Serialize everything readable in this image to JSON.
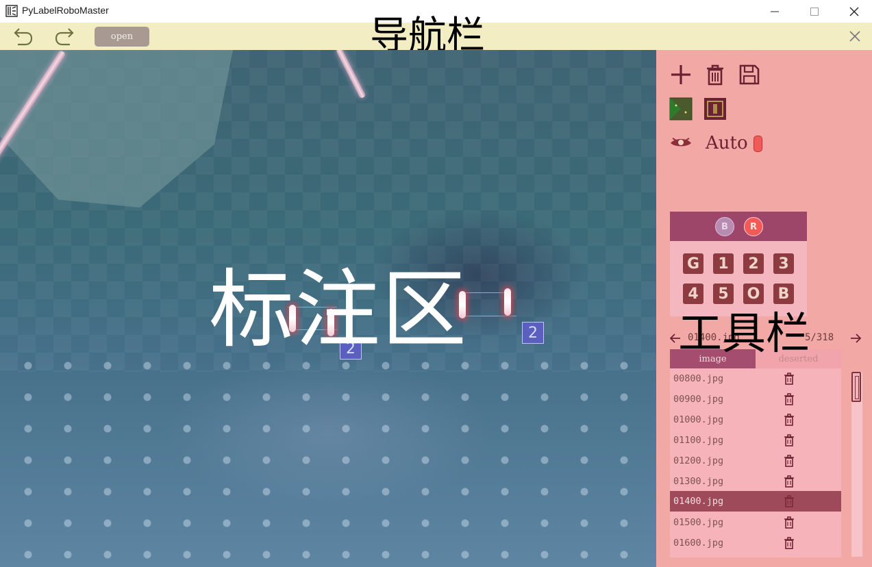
{
  "window": {
    "title": "PyLabelRoboMaster",
    "controls": [
      "minimize",
      "maximize",
      "close"
    ]
  },
  "navbar": {
    "undo_icon": "undo-arrow-icon",
    "redo_icon": "redo-arrow-icon",
    "open_label": "open",
    "overlay_label": "导航栏",
    "close_icon": "close-icon"
  },
  "canvas": {
    "overlay_label": "标注区",
    "armor_badges": [
      "2",
      "2"
    ]
  },
  "toolbar": {
    "overlay_label": "工具栏",
    "tools": [
      "add-icon",
      "delete-icon",
      "save-icon",
      "grid-icon",
      "box-icon",
      "eye-icon"
    ],
    "auto_label": "Auto",
    "team_buttons": [
      "B",
      "R"
    ],
    "selected_team": "R",
    "classes": [
      "G",
      "1",
      "2",
      "3",
      "4",
      "5",
      "O",
      "B"
    ],
    "current_file": "01400.jpg",
    "counter": "5/318",
    "tabs": [
      "image",
      "deserted"
    ],
    "active_tab": "image",
    "files": [
      "00800.jpg",
      "00900.jpg",
      "01000.jpg",
      "01100.jpg",
      "01200.jpg",
      "01300.jpg",
      "01400.jpg",
      "01500.jpg",
      "01600.jpg"
    ],
    "selected_file": "01400.jpg"
  },
  "colors": {
    "navbar_bg": "#f3edc4",
    "panel_bg": "#f2a9a6",
    "accent": "#9e466a",
    "selected_row": "#9e4a5a"
  }
}
